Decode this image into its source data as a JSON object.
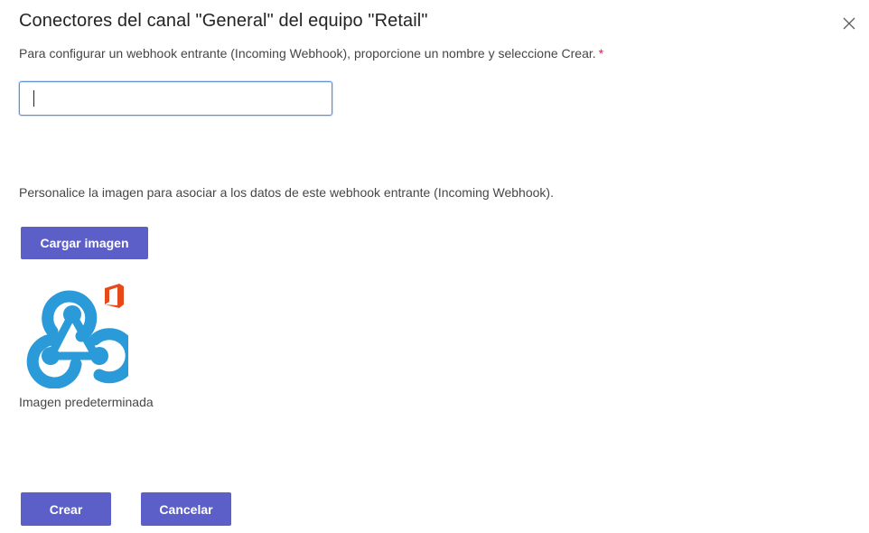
{
  "dialog": {
    "title": "Conectores del canal \"General\" del equipo \"Retail\"",
    "close_icon": "close-icon"
  },
  "form": {
    "instruction": "Para configurar un webhook entrante (Incoming Webhook), proporcione un nombre y seleccione Crear.",
    "required_mark": "*",
    "name_value": "",
    "customize_text": "Personalice la imagen para asociar a los datos de este webhook entrante (Incoming Webhook).",
    "upload_label": "Cargar imagen",
    "default_image_icon": "webhook-icon",
    "office_badge_icon": "office-logo-icon",
    "default_image_caption": "Imagen predeterminada"
  },
  "footer": {
    "create_label": "Crear",
    "cancel_label": "Cancelar"
  },
  "colors": {
    "primary_button": "#5b5fc7",
    "webhook_blue": "#2b9ad8",
    "office_red": "#e64a19",
    "required_red": "#c4314b",
    "input_focus_border": "#5b8fd6"
  }
}
